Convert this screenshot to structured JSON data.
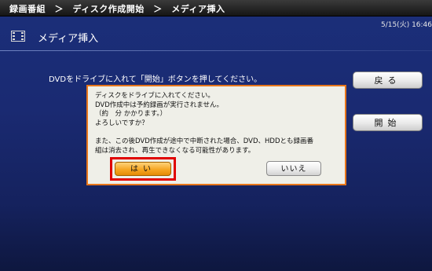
{
  "breadcrumb": "録画番組　＞　ディスク作成開始　＞　メディア挿入",
  "datetime": "5/15(火)  16:46",
  "header": {
    "icon": "film-icon",
    "title": "メディア挿入"
  },
  "instruction": "DVDをドライブに入れて「開始」ボタンを押してください。",
  "side_buttons": {
    "back_label": "戻る",
    "start_label": "開始"
  },
  "dialog": {
    "lines": [
      "ディスクをドライブに入れてください。",
      "DVD作成中は予約録画が実行されません。",
      "（約　分 かかります。）",
      "よろしいですか？",
      "また、この後DVD作成が途中で中断された場合、DVD、HDDとも録画番",
      "組は消去され、再生できなくなる可能性があります。"
    ],
    "yes_label": "はい",
    "no_label": "いいえ"
  },
  "colors": {
    "background": "#1a2a72",
    "dialog_border": "#e8761a",
    "highlight": "#e00000",
    "yes_button": "#f6a623"
  }
}
